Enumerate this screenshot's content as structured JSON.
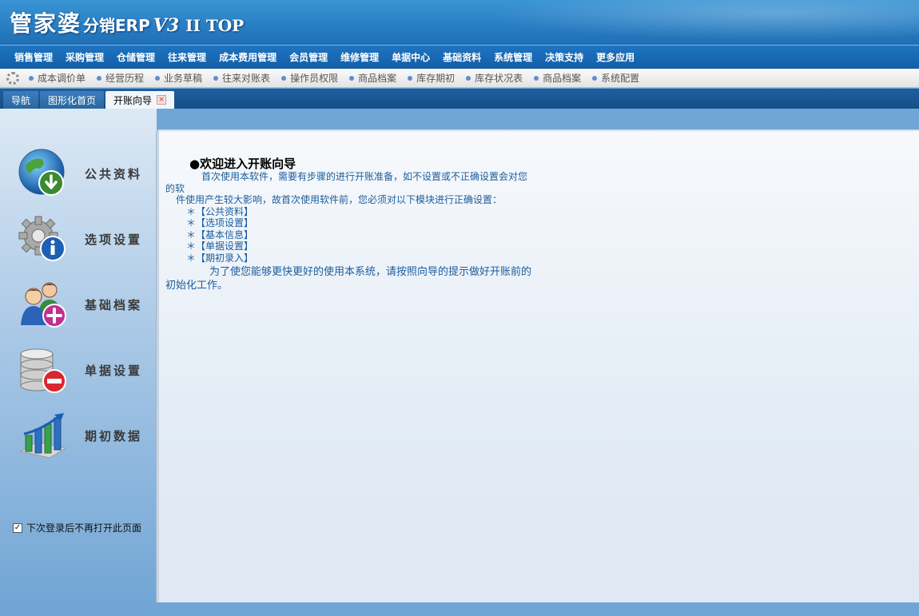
{
  "header": {
    "logo_main": "管家婆",
    "logo_sub": "分销ERP",
    "logo_version": "V3",
    "logo_edition": "II TOP"
  },
  "main_menu": {
    "items": [
      "销售管理",
      "采购管理",
      "仓储管理",
      "往来管理",
      "成本费用管理",
      "会员管理",
      "维修管理",
      "单据中心",
      "基础资料",
      "系统管理",
      "决策支持",
      "更多应用"
    ]
  },
  "quick_bar": {
    "items": [
      "成本调价单",
      "经营历程",
      "业务草稿",
      "往来对账表",
      "操作员权限",
      "商品档案",
      "库存期初",
      "库存状况表",
      "商品档案",
      "系统配置"
    ]
  },
  "tabs": {
    "items": [
      "导航",
      "图形化首页",
      "开账向导"
    ],
    "active": "开账向导",
    "close_glyph": "×"
  },
  "left_nav": {
    "items": [
      {
        "label": "公共资料",
        "icon": "globe-download-icon"
      },
      {
        "label": "选项设置",
        "icon": "gear-info-icon"
      },
      {
        "label": "基础档案",
        "icon": "users-add-icon"
      },
      {
        "label": "单据设置",
        "icon": "database-remove-icon"
      },
      {
        "label": "期初数据",
        "icon": "bar-chart-growth-icon"
      }
    ],
    "checkbox_label": "下次登录后不再打开此页面",
    "checkbox_checked": true,
    "checkbox_glyph": "✓"
  },
  "content": {
    "title": "●欢迎进入开账向导",
    "line1": "首次使用本软件，需要有步骤的进行开账准备，如不设置或不正确设置会对您",
    "line2": "的软",
    "line3": "件使用产生较大影响，故首次使用软件前，您必须对以下模块进行正确设置：",
    "modules": [
      "＊【公共资料】",
      "＊【选项设置】",
      "＊【基本信息】",
      "＊【单据设置】",
      "＊【期初录入】"
    ],
    "line4": "为了使您能够更快更好的使用本系统，请按照向导的提示做好开账前的",
    "line5": "初始化工作。"
  }
}
